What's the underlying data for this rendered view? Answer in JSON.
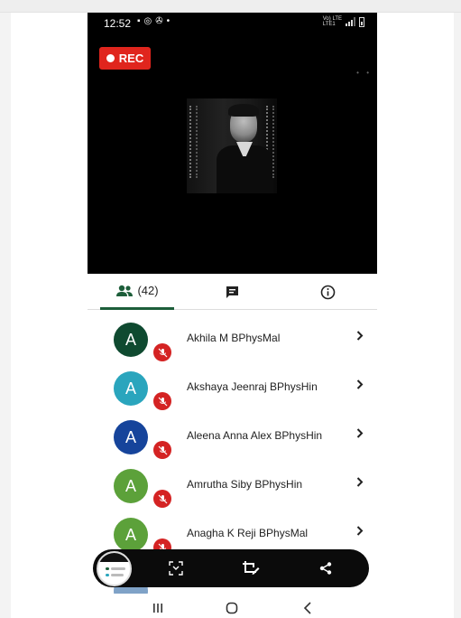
{
  "status_bar": {
    "time": "12:52",
    "network": "Vo)) LTE\nLTE1 ▲▼"
  },
  "video": {
    "rec_label": "REC"
  },
  "tabs": {
    "people_label": "(42)"
  },
  "participants": [
    {
      "initial": "A",
      "name": "Akhila M BPhysMal",
      "color": "#0f4a30"
    },
    {
      "initial": "A",
      "name": "Akshaya Jeenraj BPhysHin",
      "color": "#2aa5bd"
    },
    {
      "initial": "A",
      "name": "Aleena Anna Alex BPhysHin",
      "color": "#16449b"
    },
    {
      "initial": "A",
      "name": "Amrutha Siby BPhysHin",
      "color": "#5ca13a"
    },
    {
      "initial": "A",
      "name": "Anagha K Reji BPhysMal",
      "color": "#5ca13a"
    }
  ],
  "colors": {
    "accent": "#1d5e3a",
    "rec": "#e0251d",
    "mute": "#d42323"
  },
  "icons": [
    "people-icon",
    "chat-icon",
    "info-icon",
    "mic-off-icon",
    "chevron-right-icon",
    "screenshot-icon",
    "crop-edit-icon",
    "share-icon",
    "recents-icon",
    "home-icon",
    "back-icon"
  ]
}
